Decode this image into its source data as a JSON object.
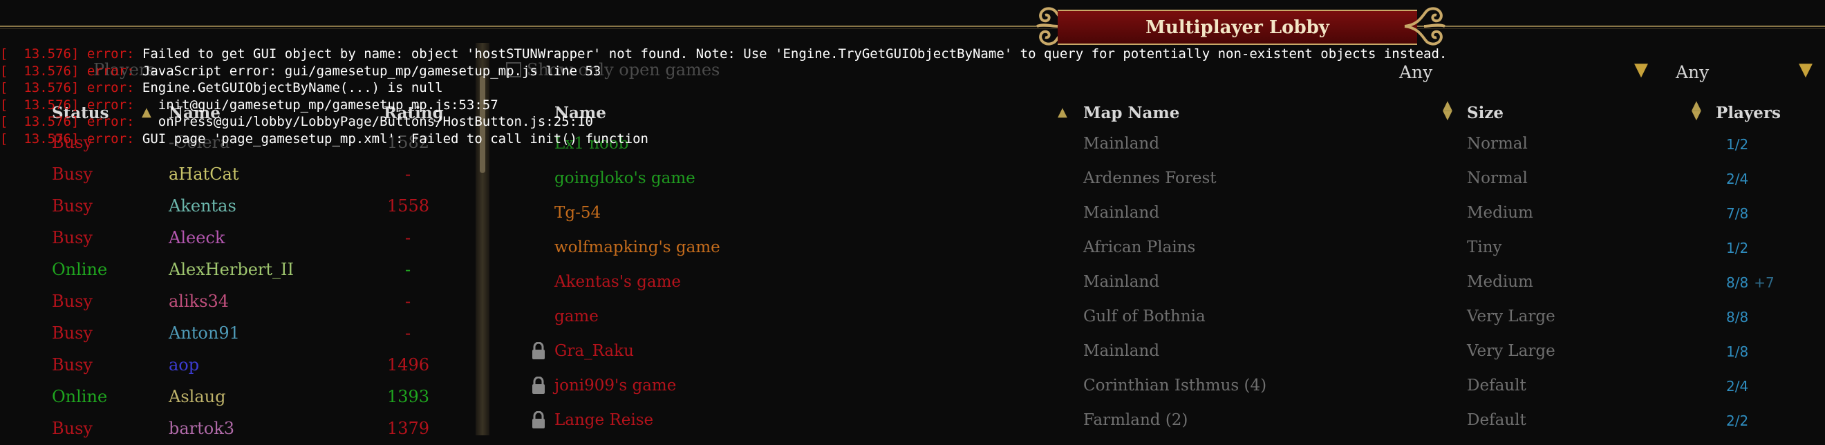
{
  "window": {
    "title": "Multiplayer Lobby"
  },
  "left": {
    "faded_heading": "Players",
    "columns": {
      "status": "Status",
      "name": "Name",
      "rating": "Rating"
    },
    "players": [
      {
        "status": "Busy",
        "name": "-Ceiera",
        "rating": "1582",
        "status_color": "#b3121b",
        "name_color": "#4d4d4d",
        "rating_color": "#4d4d4d"
      },
      {
        "status": "Busy",
        "name": "aHatCat",
        "rating": "-",
        "status_color": "#b3121b",
        "name_color": "#c9c56a",
        "rating_color": "#b3121b"
      },
      {
        "status": "Busy",
        "name": "Akentas",
        "rating": "1558",
        "status_color": "#b3121b",
        "name_color": "#6bb6ab",
        "rating_color": "#b3121b"
      },
      {
        "status": "Busy",
        "name": "Aleeck",
        "rating": "-",
        "status_color": "#b3121b",
        "name_color": "#b457b0",
        "rating_color": "#b3121b"
      },
      {
        "status": "Online",
        "name": "AlexHerbert_II",
        "rating": "-",
        "status_color": "#1fa61f",
        "name_color": "#9fc66f",
        "rating_color": "#1fa61f"
      },
      {
        "status": "Busy",
        "name": "aliks34",
        "rating": "-",
        "status_color": "#b3121b",
        "name_color": "#c04f7c",
        "rating_color": "#b3121b"
      },
      {
        "status": "Busy",
        "name": "Anton91",
        "rating": "-",
        "status_color": "#b3121b",
        "name_color": "#4f9bb8",
        "rating_color": "#b3121b"
      },
      {
        "status": "Busy",
        "name": "aop",
        "rating": "1496",
        "status_color": "#b3121b",
        "name_color": "#3c3cd2",
        "rating_color": "#b3121b"
      },
      {
        "status": "Online",
        "name": "Aslaug",
        "rating": "1393",
        "status_color": "#1fa61f",
        "name_color": "#bfb36a",
        "rating_color": "#1fa61f"
      },
      {
        "status": "Busy",
        "name": "bartok3",
        "rating": "1379",
        "status_color": "#b3121b",
        "name_color": "#b06aa8",
        "rating_color": "#b3121b"
      }
    ]
  },
  "right": {
    "faded_heading": "Show only open games",
    "filters": {
      "size": "Any",
      "players": "Any"
    },
    "columns": {
      "name": "Name",
      "map": "Map Name",
      "size": "Size",
      "players": "Players"
    },
    "games": [
      {
        "name": "Lx1 noob",
        "map": "Mainland",
        "size": "Normal",
        "players": "1/2",
        "extra": "",
        "locked": false,
        "color": "#1f8a1f"
      },
      {
        "name": "goingloko's game",
        "map": "Ardennes Forest",
        "size": "Normal",
        "players": "2/4",
        "extra": "",
        "locked": false,
        "color": "#1f9a1f"
      },
      {
        "name": "Tg-54",
        "map": "Mainland",
        "size": "Medium",
        "players": "7/8",
        "extra": "",
        "locked": false,
        "color": "#c56c1c"
      },
      {
        "name": "wolfmapking's game",
        "map": "African Plains",
        "size": "Tiny",
        "players": "1/2",
        "extra": "",
        "locked": false,
        "color": "#c56c1c"
      },
      {
        "name": "Akentas's game",
        "map": "Mainland",
        "size": "Medium",
        "players": "8/8",
        "extra": "+7",
        "locked": false,
        "color": "#b3121b"
      },
      {
        "name": "game",
        "map": "Gulf of Bothnia",
        "size": "Very Large",
        "players": "8/8",
        "extra": "",
        "locked": false,
        "color": "#b3121b"
      },
      {
        "name": "Gra_Raku",
        "map": "Mainland",
        "size": "Very Large",
        "players": "1/8",
        "extra": "",
        "locked": true,
        "color": "#b3121b"
      },
      {
        "name": "joni909's game",
        "map": "Corinthian Isthmus (4)",
        "size": "Default",
        "players": "2/4",
        "extra": "",
        "locked": true,
        "color": "#b3121b"
      },
      {
        "name": "Lange Reise",
        "map": "Farmland (2)",
        "size": "Default",
        "players": "2/2",
        "extra": "",
        "locked": true,
        "color": "#b3121b"
      }
    ]
  },
  "console": [
    {
      "prefix": "[  13.576] error: ",
      "text": "Failed to get GUI object by name: object 'hostSTUNWrapper' not found. Note: Use 'Engine.TryGetGUIObjectByName' to query for potentially non-existent objects instead."
    },
    {
      "prefix": "[  13.576] error: ",
      "text": "JavaScript error: gui/gamesetup_mp/gamesetup_mp.js line 53"
    },
    {
      "prefix": "[  13.576] error: ",
      "text": "Engine.GetGUIObjectByName(...) is null"
    },
    {
      "prefix": "[  13.576] error: ",
      "text": "  init@gui/gamesetup_mp/gamesetup_mp.js:53:57"
    },
    {
      "prefix": "[  13.576] error: ",
      "text": "  onPress@gui/lobby/LobbyPage/Buttons/HostButton.js:25:10"
    },
    {
      "prefix": "[  13.576] error: ",
      "text": "GUI page 'page_gamesetup_mp.xml': Failed to call init() function"
    }
  ]
}
